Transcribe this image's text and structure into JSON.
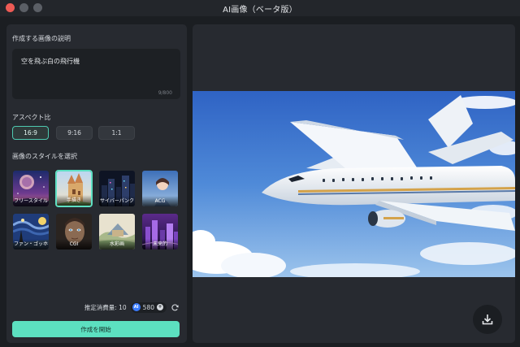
{
  "window": {
    "title": "AI画像（ベータ版）"
  },
  "prompt": {
    "label": "作成する画像の説明",
    "text": "空を飛ぶ白の飛行機",
    "count": "9/800"
  },
  "aspect": {
    "label": "アスペクト比",
    "options": [
      "16:9",
      "9:16",
      "1:1"
    ],
    "selected": "16:9"
  },
  "styles": {
    "label": "画像のスタイルを選択",
    "items": [
      {
        "label": "フリースタイル",
        "icon": "galaxy-art"
      },
      {
        "label": "手描き",
        "icon": "castle-art",
        "selected": true
      },
      {
        "label": "サイバーパンク",
        "icon": "city-art"
      },
      {
        "label": "ACG",
        "icon": "anime-art"
      },
      {
        "label": "ファン・ゴッホ",
        "icon": "starry-night-art"
      },
      {
        "label": "CGI",
        "icon": "robot-face-art"
      },
      {
        "label": "水彩画",
        "icon": "watercolor-art"
      },
      {
        "label": "未来的",
        "icon": "futuristic-city-art"
      }
    ]
  },
  "cost": {
    "label": "推定消費量: 10",
    "credits": "580",
    "ai_badge": "AI"
  },
  "generate": {
    "label": "作成を開始"
  },
  "colors": {
    "accent": "#5ce0c0",
    "panel": "#272a30",
    "background": "#1b1e22"
  }
}
